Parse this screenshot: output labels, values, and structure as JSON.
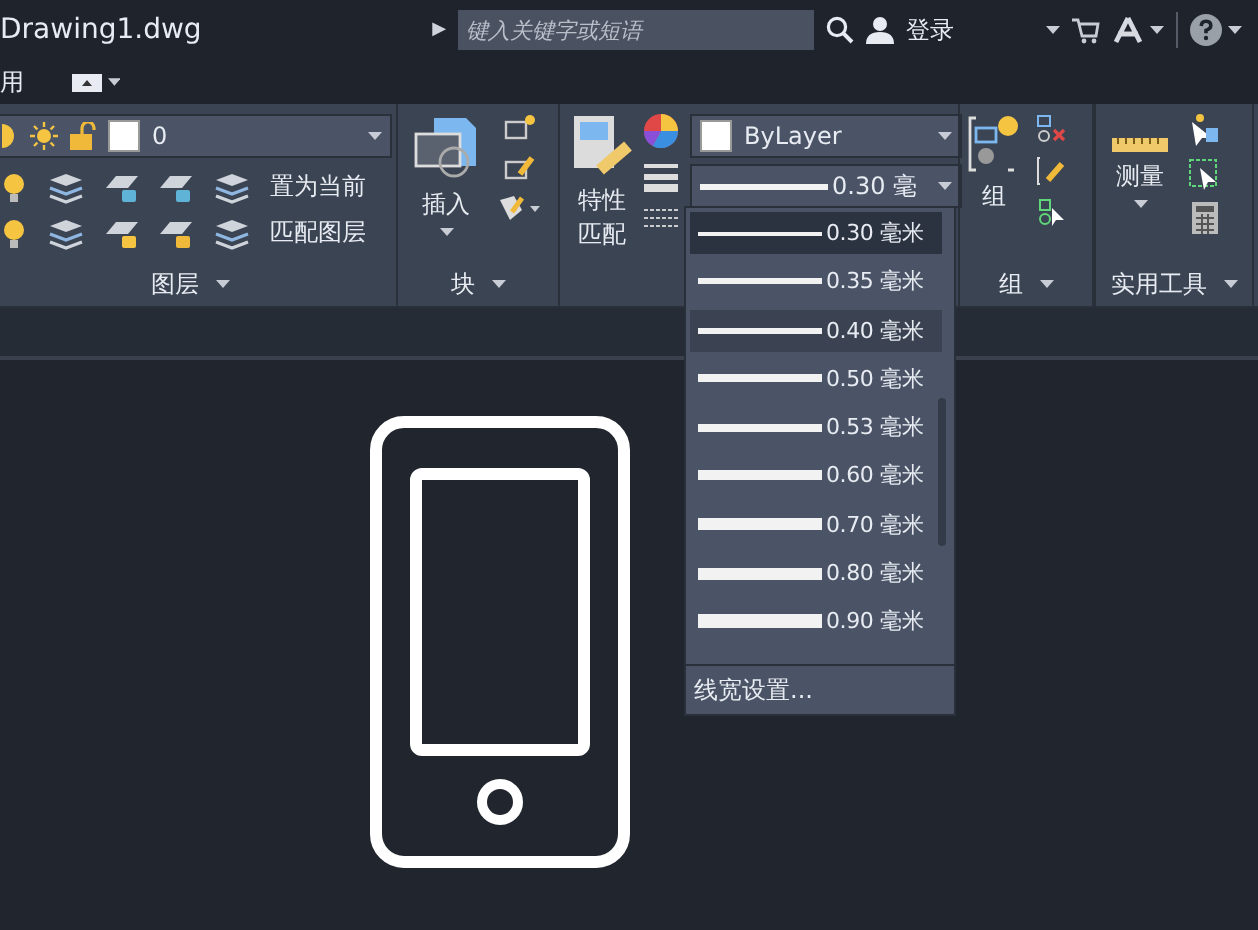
{
  "title_bar": {
    "file_name": "Drawing1.dwg",
    "expand_glyph": "▶",
    "search": {
      "placeholder": "键入关键字或短语"
    },
    "sign_in": "登录"
  },
  "menu_row": {
    "label": "用"
  },
  "ribbon": {
    "layer_panel": {
      "current_layer": "0",
      "buttons": [
        "置为当前",
        "匹配图层"
      ],
      "title": "图层"
    },
    "block_panel": {
      "insert": "插入",
      "title": "块"
    },
    "properties_panel": {
      "match": "特性匹配",
      "color_setting": "ByLayer",
      "lineweight": "0.30 毫"
    },
    "group_panel": {
      "group": "组",
      "title": "组"
    },
    "utilities_panel": {
      "measure": "测量",
      "title": "实用工具"
    }
  },
  "lineweight_dropdown": {
    "items": [
      {
        "label": "0.30 毫米",
        "selected": true,
        "hovered": false
      },
      {
        "label": "0.35 毫米",
        "selected": false,
        "hovered": false
      },
      {
        "label": "0.40 毫米",
        "selected": false,
        "hovered": true
      },
      {
        "label": "0.50 毫米",
        "selected": false,
        "hovered": false
      },
      {
        "label": "0.53 毫米",
        "selected": false,
        "hovered": false
      },
      {
        "label": "0.60 毫米",
        "selected": false,
        "hovered": false
      },
      {
        "label": "0.70 毫米",
        "selected": false,
        "hovered": false
      },
      {
        "label": "0.80 毫米",
        "selected": false,
        "hovered": false
      },
      {
        "label": "0.90 毫米",
        "selected": false,
        "hovered": false
      }
    ],
    "footer": "线宽设置..."
  }
}
